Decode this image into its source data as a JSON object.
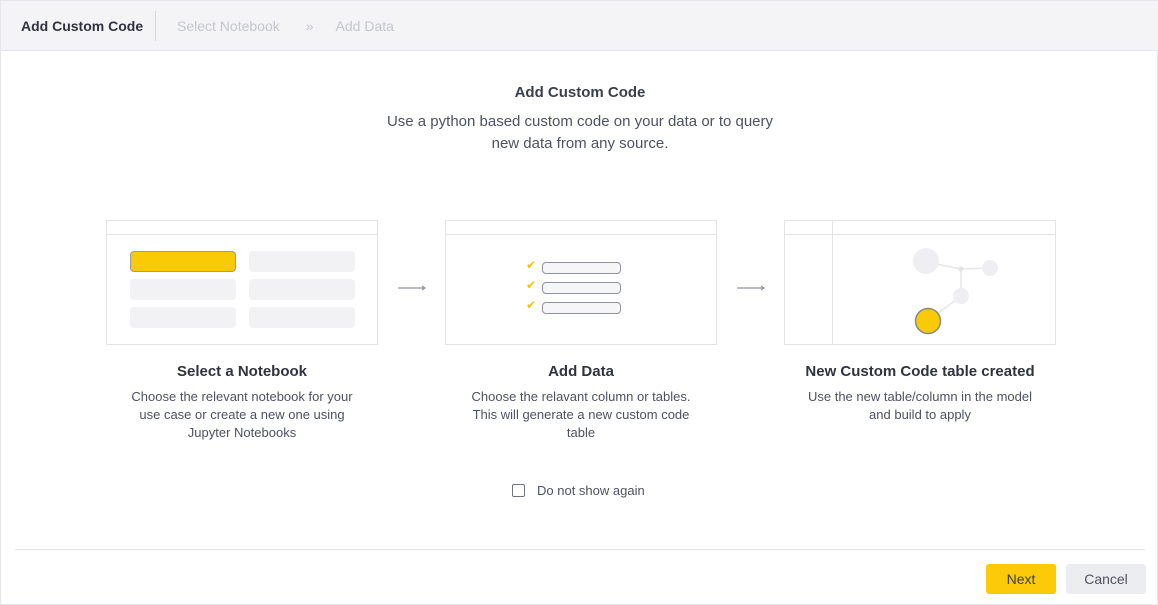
{
  "wizard": {
    "current_step": "Add Custom Code",
    "next_step": "Select Notebook",
    "separator": "»",
    "last_step": "Add Data"
  },
  "intro": {
    "title": "Add Custom Code",
    "description": "Use a python based custom code on your data or to query new data from any source."
  },
  "steps": [
    {
      "title": "Select a Notebook",
      "description": "Choose the relevant notebook for your use case or create a new one using Jupyter Notebooks"
    },
    {
      "title": "Add Data",
      "description": "Choose the relavant column or tables. This will generate a new custom code table"
    },
    {
      "title": "New Custom Code table created",
      "description": "Use the new table/column in the model and build to apply"
    }
  ],
  "checkbox": {
    "label": "Do not show again",
    "checked": false
  },
  "buttons": {
    "next": "Next",
    "cancel": "Cancel"
  },
  "colors": {
    "accent": "#fcca08",
    "header_bg": "#f4f4f7",
    "cancel_bg": "#ecedf1"
  },
  "icons": [
    "arrow-right-icon",
    "check-icon",
    "checkbox-icon"
  ]
}
